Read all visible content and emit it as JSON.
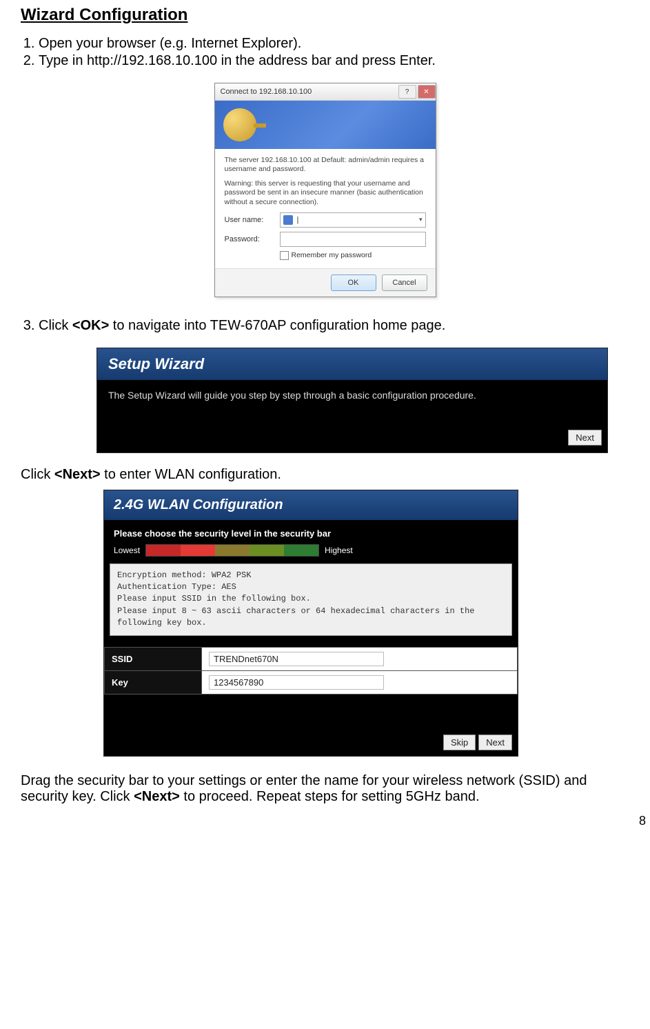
{
  "title": "Wizard Configuration",
  "steps": {
    "s1": "Open your browser (e.g. Internet Explorer).",
    "s2": "Type in http://192.168.10.100 in the address bar and press Enter."
  },
  "cred": {
    "title": "Connect to 192.168.10.100",
    "line1": "The server 192.168.10.100 at Default: admin/admin requires a username and password.",
    "line2": "Warning: this server is requesting that your username and password be sent in an insecure manner (basic authentication without a secure connection).",
    "user_label": "User name:",
    "user_value": "",
    "pass_label": "Password:",
    "remember": "Remember my password",
    "ok": "OK",
    "cancel": "Cancel"
  },
  "step3_prefix": "Click ",
  "step3_bold": "<OK>",
  "step3_suffix": " to navigate into TEW-670AP configuration home page.",
  "wizard": {
    "header": "Setup Wizard",
    "body": "The Setup Wizard will guide you step by step through a basic configuration procedure.",
    "next": "Next"
  },
  "click_next_prefix": "Click ",
  "click_next_bold": "<Next>",
  "click_next_suffix": " to enter WLAN configuration.",
  "wlan": {
    "header": "2.4G  WLAN Configuration",
    "subtitle": "Please choose the security level in the security bar",
    "lowest": "Lowest",
    "highest": "Highest",
    "info_l1": "Encryption method: WPA2 PSK",
    "info_l2": "Authentication Type: AES",
    "info_l3": "Please input SSID in the following box.",
    "info_l4": "Please input 8 ~ 63 ascii characters or 64 hexadecimal characters in the following key box.",
    "ssid_label": "SSID",
    "ssid_value": "TRENDnet670N",
    "key_label": "Key",
    "key_value": "1234567890",
    "skip": "Skip",
    "next": "Next"
  },
  "final_p1": "Drag the security bar to your settings or enter the name for your wireless network (SSID) and security key. Click ",
  "final_bold": "<Next>",
  "final_p2": " to proceed. Repeat steps for setting 5GHz band.",
  "page_no": "8"
}
